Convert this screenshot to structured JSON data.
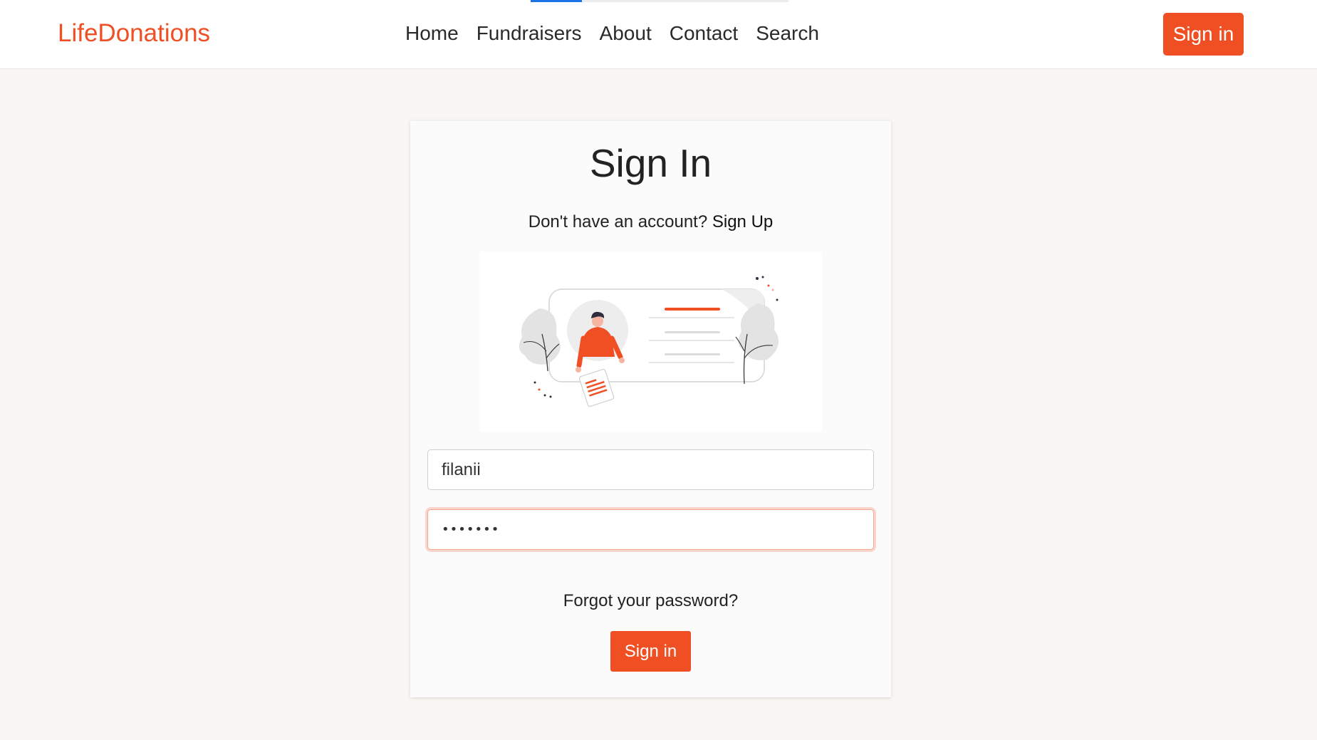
{
  "brand": "LifeDonations",
  "nav": {
    "items": [
      {
        "label": "Home"
      },
      {
        "label": "Fundraisers"
      },
      {
        "label": "About"
      },
      {
        "label": "Contact"
      },
      {
        "label": "Search"
      }
    ]
  },
  "header": {
    "signin_label": "Sign in"
  },
  "card": {
    "title": "Sign In",
    "signup_prompt": "Don't have an account?",
    "signup_link": "Sign Up",
    "username_value": "filanii",
    "password_value": "•••••••",
    "forgot_label": "Forgot your password?",
    "signin_label": "Sign in"
  },
  "colors": {
    "accent": "#f04e23",
    "page_background": "#f9f6f3",
    "loading_bar": "#1a73e8"
  }
}
